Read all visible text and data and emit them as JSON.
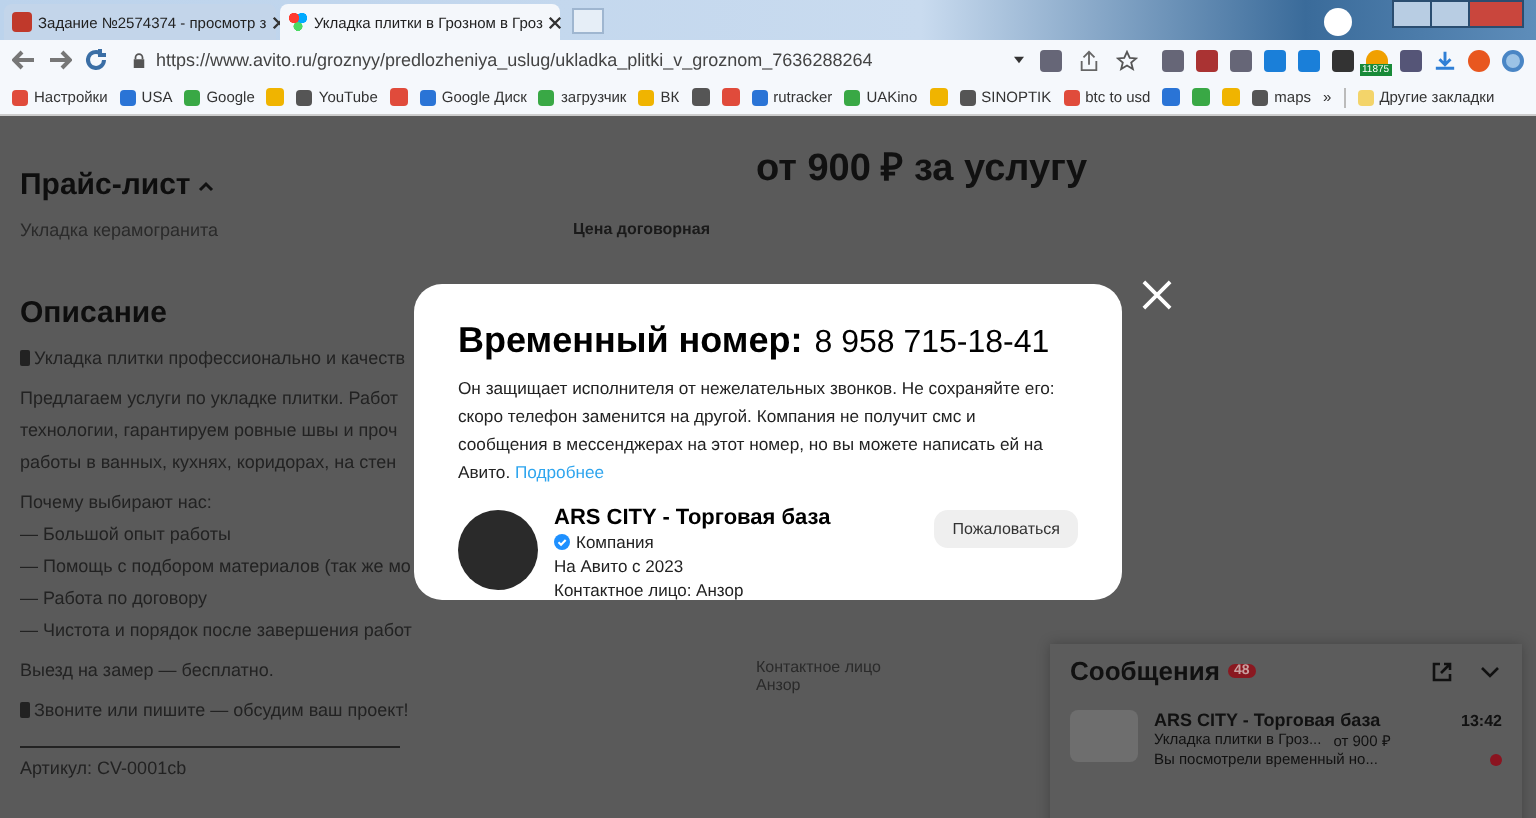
{
  "browser": {
    "tabs": [
      {
        "title": "Задание №2574374 - просмотр з",
        "selected": false
      },
      {
        "title": "Укладка плитки в Грозном в Гроз",
        "selected": true
      }
    ],
    "url": "https://www.avito.ru/groznyy/predlozheniya_uslug/ukladka_plitki_v_groznom_7636288264",
    "extension_badge": "11875",
    "bookmarks": [
      {
        "kind": "link",
        "label": "Настройки"
      },
      {
        "kind": "link",
        "label": "USA"
      },
      {
        "kind": "link",
        "label": "Google"
      },
      {
        "kind": "icon"
      },
      {
        "kind": "link",
        "label": "YouTube"
      },
      {
        "kind": "icon"
      },
      {
        "kind": "link",
        "label": "Google Диск"
      },
      {
        "kind": "link",
        "label": "загрузчик"
      },
      {
        "kind": "link",
        "label": "ВК"
      },
      {
        "kind": "icon"
      },
      {
        "kind": "icon"
      },
      {
        "kind": "link",
        "label": "rutracker"
      },
      {
        "kind": "link",
        "label": "UAKino"
      },
      {
        "kind": "icon"
      },
      {
        "kind": "link",
        "label": "SINOPTIK"
      },
      {
        "kind": "link",
        "label": "btc to usd"
      },
      {
        "kind": "icon"
      },
      {
        "kind": "icon"
      },
      {
        "kind": "icon"
      },
      {
        "kind": "link",
        "label": "maps"
      }
    ],
    "more": "»",
    "other_bookmarks": "Другие закладки"
  },
  "page": {
    "price_list": {
      "title": "Прайс-лист",
      "items": [
        {
          "name": "Укладка керамогранита",
          "price": "Цена договорная"
        }
      ]
    },
    "description": {
      "title": "Описание",
      "blocks": [
        {
          "kind": "icon_line",
          "lines": [
            "Укладка плитки профессионально и качеств"
          ]
        },
        {
          "kind": "text",
          "lines": [
            "Предлагаем услуги по укладке плитки. Работ",
            "технологии, гарантируем ровные швы и проч",
            "работы в ванных, кухнях, коридорах, на стен"
          ]
        },
        {
          "kind": "text",
          "lines": [
            "Почему выбирают нас:",
            "— Большой опыт работы",
            "— Помощь с подбором материалов (так же мо",
            "— Работа по договору",
            "— Чистота и порядок после завершения работ"
          ]
        },
        {
          "kind": "text",
          "lines": [
            "Выезд на замер — бесплатно."
          ]
        },
        {
          "kind": "icon_line",
          "lines": [
            "Звоните или пишите — обсудим ваш проект!"
          ]
        }
      ],
      "article": "Артикул: CV-0001cb"
    },
    "price": "от 900 ₽ за услугу",
    "contact": {
      "label": "Контактное лицо",
      "name": "Анзор"
    }
  },
  "modal": {
    "title": "Временный номер:",
    "phone": "8 958 715-18-41",
    "text": "Он защищает исполнителя от нежелательных звонков. Не сохраняйте его: скоро телефон заменится на другой. Компания не получит смс и сообщения в мессенджерах на этот номер, но вы можете написать ей на Авито.",
    "link": "Подробнее",
    "seller": {
      "name": "ARS CITY - Торговая база",
      "verified": true,
      "type": "Компания",
      "since": "На Авито с 2023",
      "contact": "Контактное лицо: Анзор"
    },
    "report_button": "Пожаловаться"
  },
  "messages": {
    "title": "Сообщения",
    "count": "48",
    "chats": [
      {
        "name": "ARS CITY - Торговая база",
        "time": "13:42",
        "subject": "Укладка плитки в Гроз...",
        "price": "от 900 ₽",
        "preview": "Вы посмотрели временный но...",
        "unread": true
      }
    ]
  }
}
